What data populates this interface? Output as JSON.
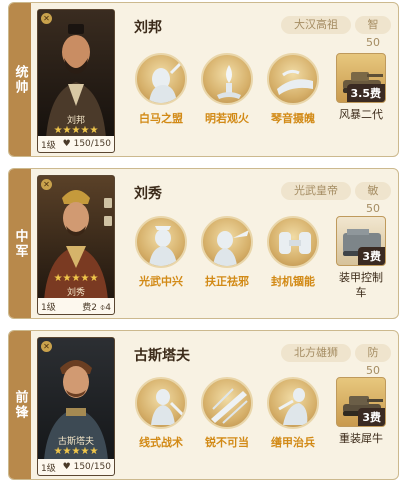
{
  "cards": [
    {
      "position_label": "统帅",
      "portrait_name": "刘邦",
      "stars": "★★★★★",
      "level": "1级",
      "troops": "150/150",
      "hero_name": "刘邦",
      "title_tag": "大汉高祖",
      "stat_tag": "智50",
      "skills": [
        "白马之盟",
        "明若观火",
        "琴音摄魄"
      ],
      "equipment": {
        "name": "风暴二代",
        "cost": "3.5费"
      }
    },
    {
      "position_label": "中军",
      "portrait_name": "刘秀",
      "stars": "★★★★★",
      "level": "1级",
      "cost_text": "费2",
      "troops_text": "4",
      "hero_name": "刘秀",
      "title_tag": "光武皇帝",
      "stat_tag": "敏50",
      "skills": [
        "光武中兴",
        "扶正祛邪",
        "封机锢能"
      ],
      "equipment": {
        "name": "装甲控制车",
        "name_line1": "装甲控制",
        "name_line2": "车",
        "cost": "3费"
      }
    },
    {
      "position_label": "前锋",
      "portrait_name": "古斯塔夫",
      "stars": "★★★★★",
      "level": "1级",
      "troops": "150/150",
      "hero_name": "古斯塔夫",
      "title_tag": "北方雄狮",
      "stat_tag": "防50",
      "skills": [
        "线式战术",
        "锐不可当",
        "缮甲治兵"
      ],
      "equipment": {
        "name": "重装犀牛",
        "cost": "3费"
      }
    }
  ],
  "colors": {
    "card_bg": "#f8f2e3",
    "position_strip": "#b8894b",
    "skill_label": "#d28a16",
    "tag_bg": "#efe4cd",
    "tag_text": "#a58d63",
    "star": "#f0c64a"
  },
  "icons": {
    "close": "x-icon",
    "heart": "heart-icon",
    "shield": "shield-icon"
  }
}
